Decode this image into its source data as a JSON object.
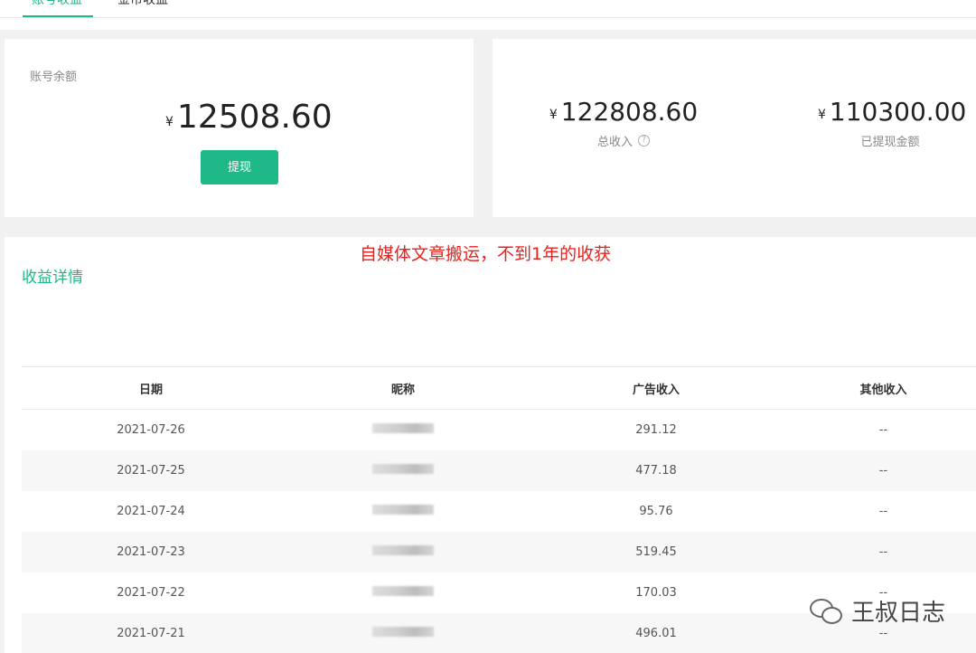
{
  "tabs": [
    "账号收益",
    "金币收益"
  ],
  "balance": {
    "label": "账号余额",
    "currency": "¥",
    "amount": "12508.60",
    "withdraw_label": "提现"
  },
  "totals": {
    "total_income": {
      "currency": "¥",
      "amount": "122808.60",
      "label": "总收入"
    },
    "withdrawn": {
      "currency": "¥",
      "amount": "110300.00",
      "label": "已提现金额"
    }
  },
  "annotation": "自媒体文章搬运，不到1年的收获",
  "detail": {
    "title": "收益详情",
    "columns": [
      "日期",
      "昵称",
      "广告收入",
      "其他收入"
    ],
    "rows": [
      {
        "date": "2021-07-26",
        "ad": "291.12",
        "other": "--"
      },
      {
        "date": "2021-07-25",
        "ad": "477.18",
        "other": "--"
      },
      {
        "date": "2021-07-24",
        "ad": "95.76",
        "other": "--"
      },
      {
        "date": "2021-07-23",
        "ad": "519.45",
        "other": "--"
      },
      {
        "date": "2021-07-22",
        "ad": "170.03",
        "other": "--"
      },
      {
        "date": "2021-07-21",
        "ad": "496.01",
        "other": "--"
      }
    ]
  },
  "watermark": {
    "text": "王叔日志",
    "icon": "wechat-icon"
  },
  "colors": {
    "accent": "#1fb888",
    "annotation": "#e6221d"
  }
}
